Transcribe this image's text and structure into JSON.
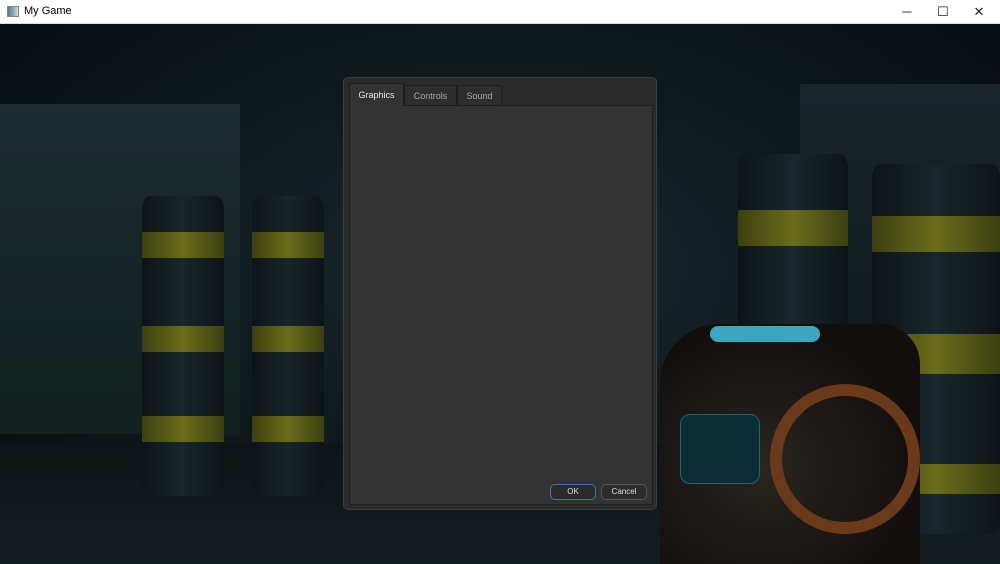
{
  "window": {
    "title": "My Game",
    "controls": {
      "minimize": "─",
      "maximize": "☐",
      "close": "✕"
    }
  },
  "dialog": {
    "tabs": [
      {
        "label": "Graphics",
        "active": true
      },
      {
        "label": "Controls",
        "active": false
      },
      {
        "label": "Sound",
        "active": false
      }
    ],
    "ok_label": "OK",
    "cancel_label": "Cancel"
  }
}
